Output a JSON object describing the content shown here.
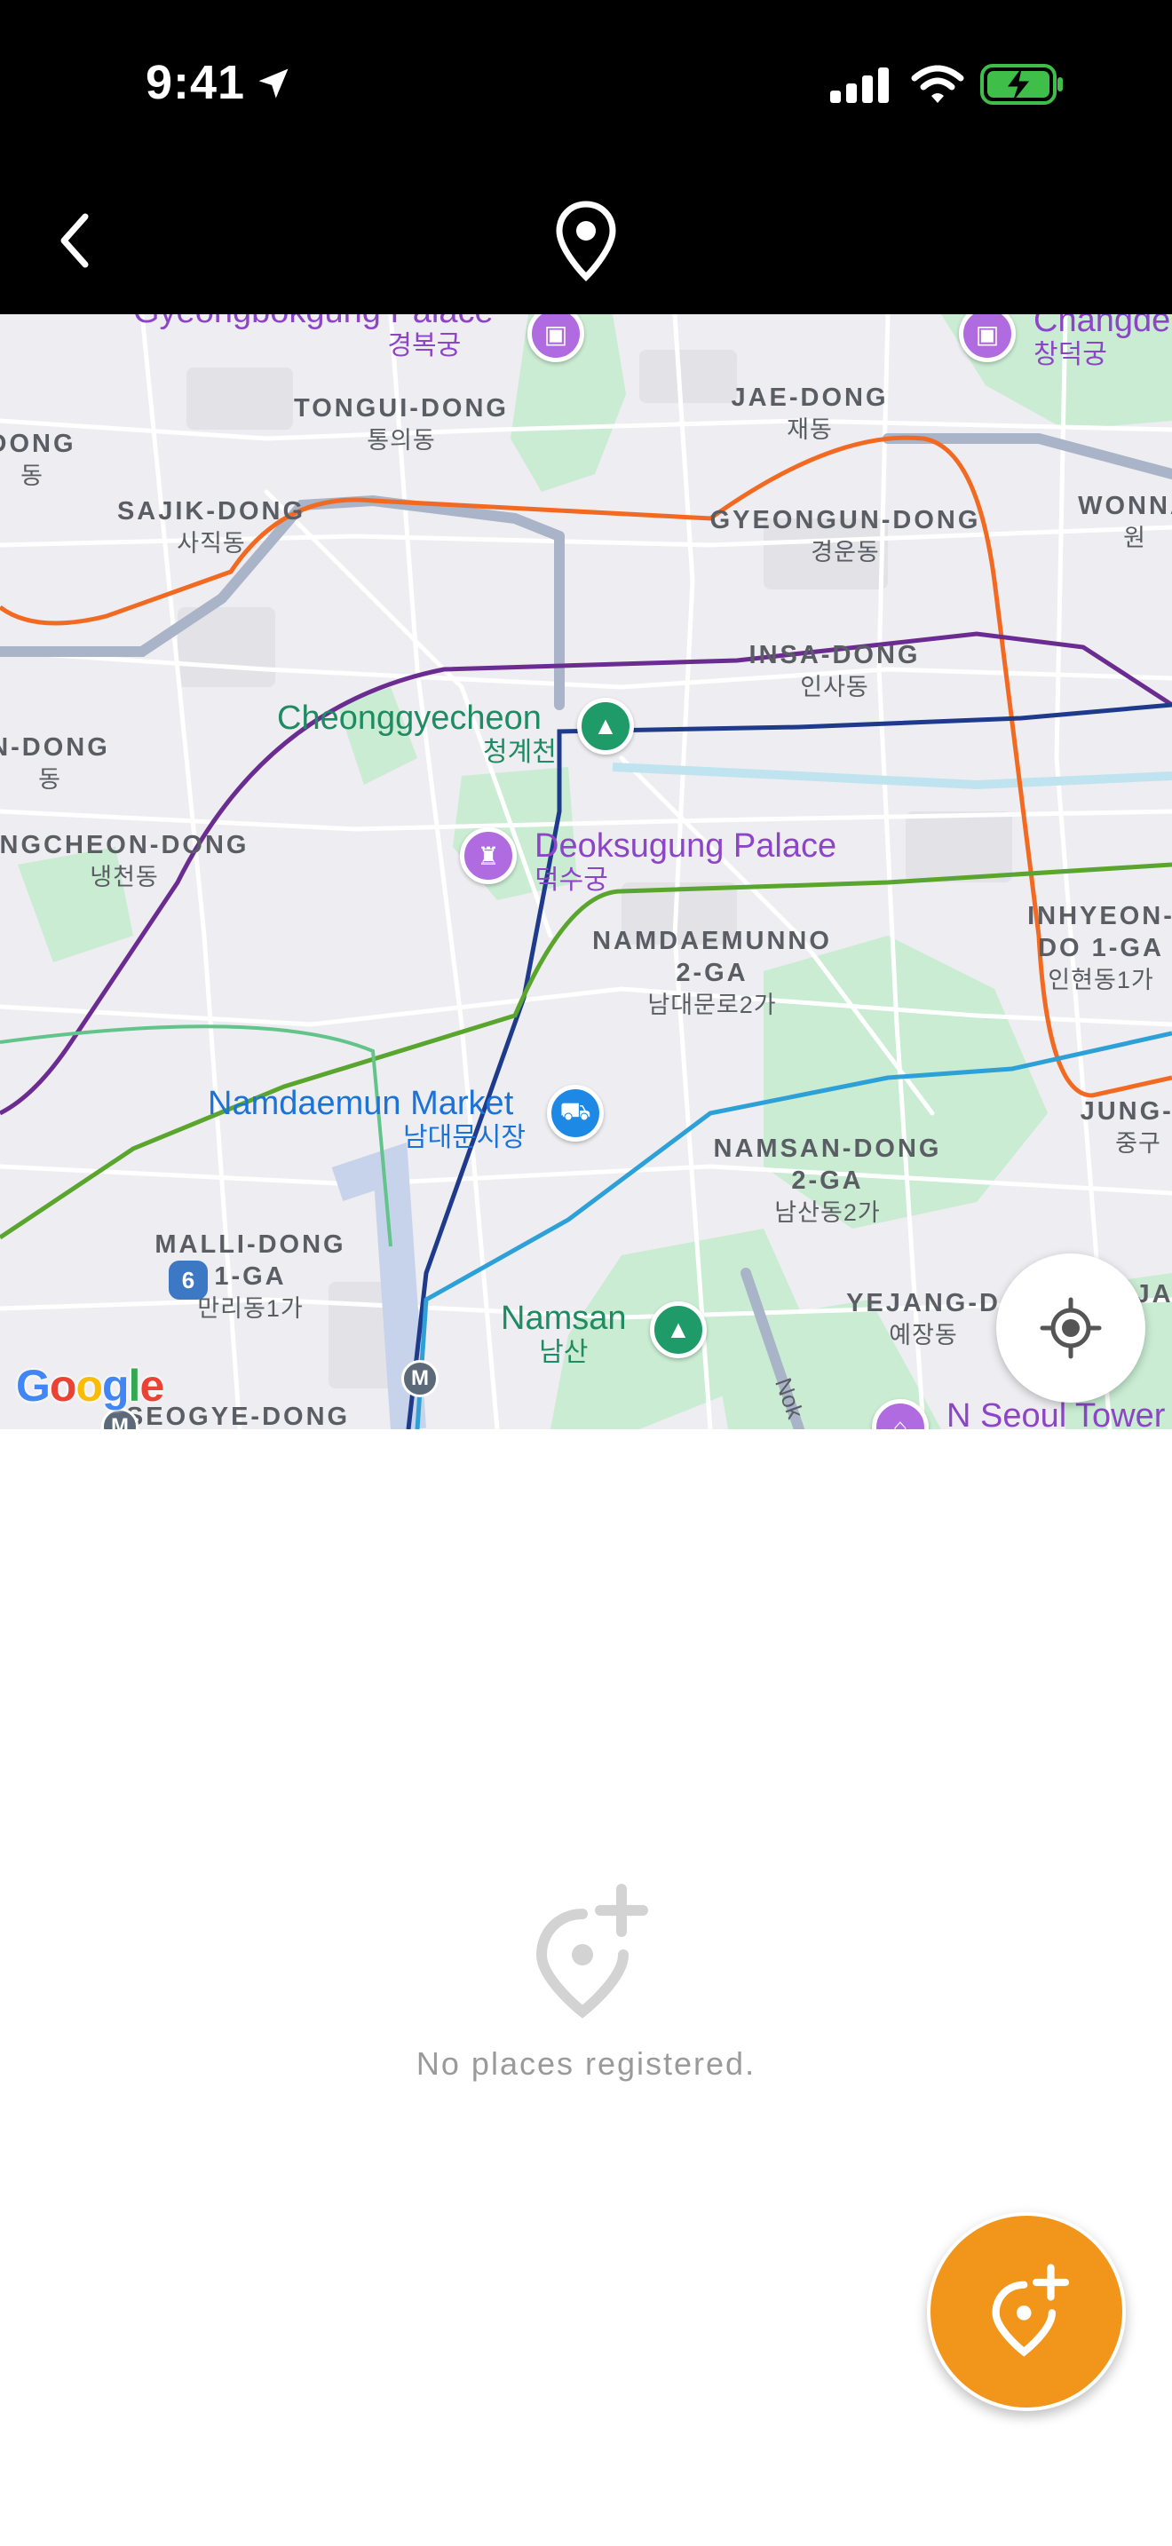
{
  "status_bar": {
    "time": "9:41"
  },
  "nav": {
    "back_icon": "chevron-left-icon",
    "title_icon": "map-pin-icon"
  },
  "map": {
    "districts": [
      {
        "en": "TONGUI-DONG",
        "kr": "통의동"
      },
      {
        "en": "JAE-DONG",
        "kr": "재동"
      },
      {
        "en": "SAJIK-DONG",
        "kr": "사직동"
      },
      {
        "en": "GYEONGUN-DONG",
        "kr": "경운동"
      },
      {
        "en": "WONNA",
        "kr": "원"
      },
      {
        "en": "INSA-DONG",
        "kr": "인사동"
      },
      {
        "en": "N-DONG",
        "kr": "동"
      },
      {
        "en": "NGCHEON-DONG",
        "kr": "냉천동"
      },
      {
        "en": "NAMDAEMUNNO 2-GA",
        "kr": "남대문로2가"
      },
      {
        "en": "INHYEON-DO 1-GA",
        "kr": "인현동1가"
      },
      {
        "en": "JUNG-G",
        "kr": "중구"
      },
      {
        "en": "NAMSAN-DONG 2-GA",
        "kr": "남산동2가"
      },
      {
        "en": "MALLI-DONG 1-GA",
        "kr": "만리동1가"
      },
      {
        "en": "YEJANG-D",
        "kr": "예장동"
      },
      {
        "en": "SEOGYE-DONG",
        "kr": ""
      },
      {
        "en": "DONG",
        "kr": "동"
      },
      {
        "en": "JA",
        "kr": ""
      }
    ],
    "pois": [
      {
        "en": "Gyeongbokgung Palace",
        "kr": "경복궁"
      },
      {
        "en": "Changde",
        "kr": "창덕궁"
      },
      {
        "en": "Cheonggyecheon",
        "kr": "청계천"
      },
      {
        "en": "Deoksugung Palace",
        "kr": "덕수궁"
      },
      {
        "en": "Namdaemun Market",
        "kr": "남대문시장"
      },
      {
        "en": "Namsan",
        "kr": "남산"
      },
      {
        "en": "N Seoul Tower",
        "kr": ""
      }
    ],
    "road_label": "Nok",
    "route_badge": "6",
    "metro_label": "M",
    "attribution": "Google",
    "locate_icon": "crosshair-icon"
  },
  "empty_state": {
    "icon": "map-pin-plus-icon",
    "message": "No places registered."
  },
  "fab": {
    "icon": "map-pin-plus-icon"
  },
  "colors": {
    "accent": "#f1961b",
    "line_orange": "#f26a21",
    "line_purple": "#6b2c91",
    "line_navy": "#1e3a8a",
    "line_green": "#5aa52e",
    "line_blue": "#2ea0d8",
    "park": "#c9ecd2"
  }
}
